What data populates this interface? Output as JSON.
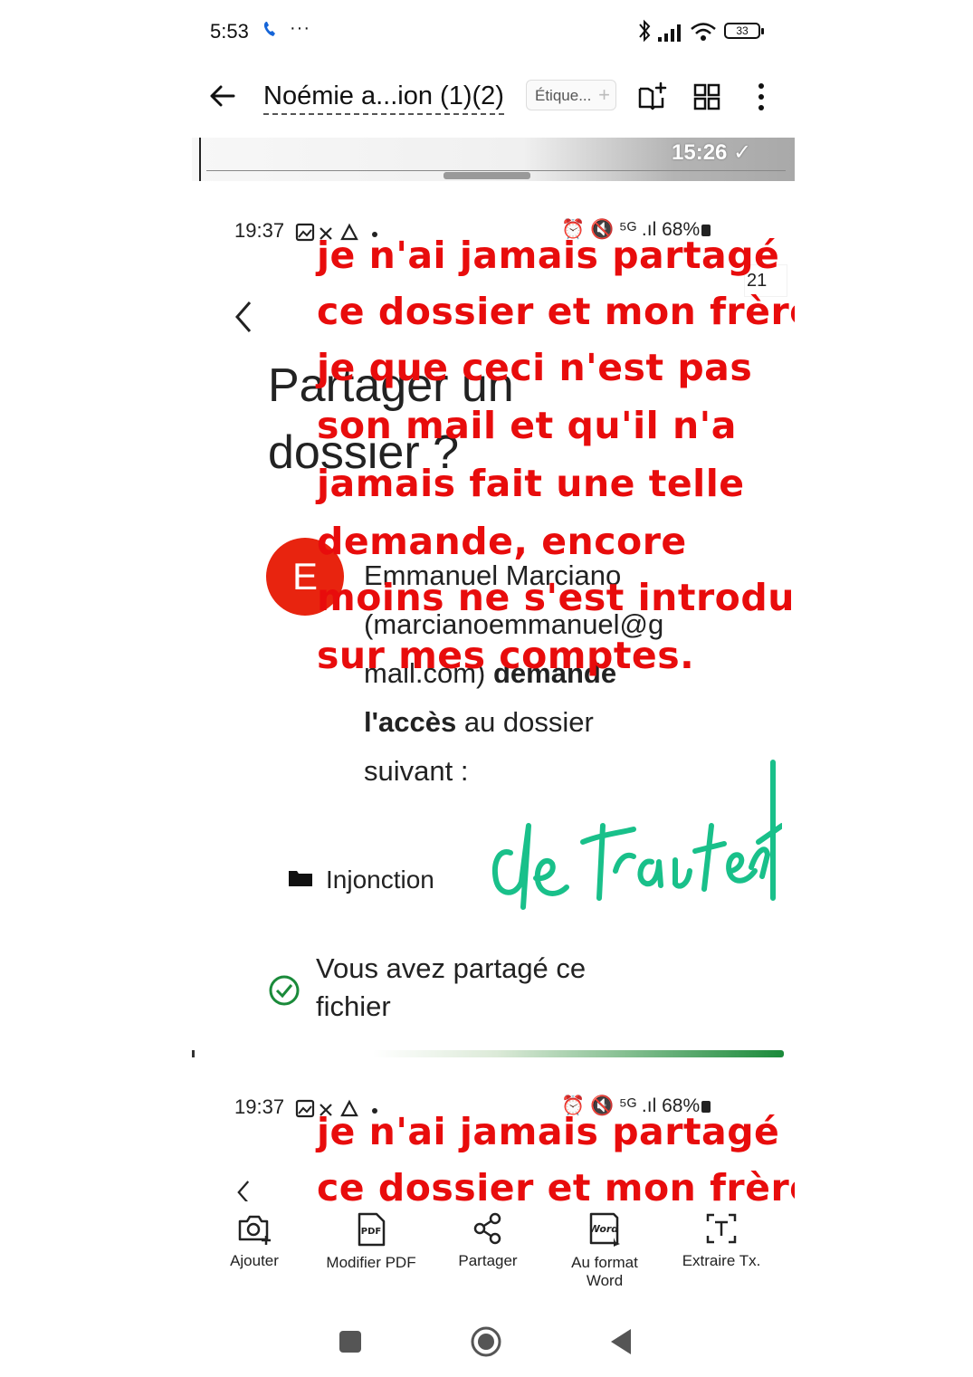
{
  "status_bar": {
    "time": "5:53",
    "dots": "···",
    "battery": "33"
  },
  "toolbar": {
    "title": "Noémie a...ion (1)(2)",
    "tag_placeholder": "Étique...",
    "tag_plus": "+"
  },
  "document": {
    "top_timestamp": "15:26 ✓",
    "screenshot_status": {
      "time": "19:37",
      "battery": "68%"
    },
    "page_number": "21",
    "heading_lines": [
      "Partager un",
      "dossier ?"
    ],
    "avatar_letter": "E",
    "request_lines": [
      "Emmanuel Marciano",
      "(marcianoemmanuel@g",
      "mail.com)"
    ],
    "request_bold": "demande",
    "access_bold": "l'accès",
    "access_rest": "au dossier",
    "suivant": "suivant :",
    "folder_name": "Injonction",
    "shared_lines": [
      "Vous avez partagé ce",
      "fichier"
    ],
    "annotation_lines": [
      "je n'ai jamais partagé",
      "ce dossier et mon frère",
      "je que ceci n'est pas",
      "son mail et qu'il n'a",
      "jamais fait une telle",
      "demande,  encore",
      "moins ne s'est introduit",
      "sur mes comptes."
    ],
    "annotation_repeat_lines": [
      "je n'ai jamais partagé",
      "ce dossier et mon frère"
    ],
    "annotation_color": "#e80c0c",
    "signature_color": "#19c08a"
  },
  "actions": [
    {
      "label": "Ajouter",
      "icon": "camera-add-icon"
    },
    {
      "label": "Modifier PDF",
      "icon": "pdf-icon"
    },
    {
      "label": "Partager",
      "icon": "share-icon"
    },
    {
      "label": "Au format Word",
      "icon": "word-icon"
    },
    {
      "label": "Extraire Tx.",
      "icon": "extract-text-icon"
    }
  ],
  "pdf_badge": "PDF",
  "word_badge": "Word"
}
